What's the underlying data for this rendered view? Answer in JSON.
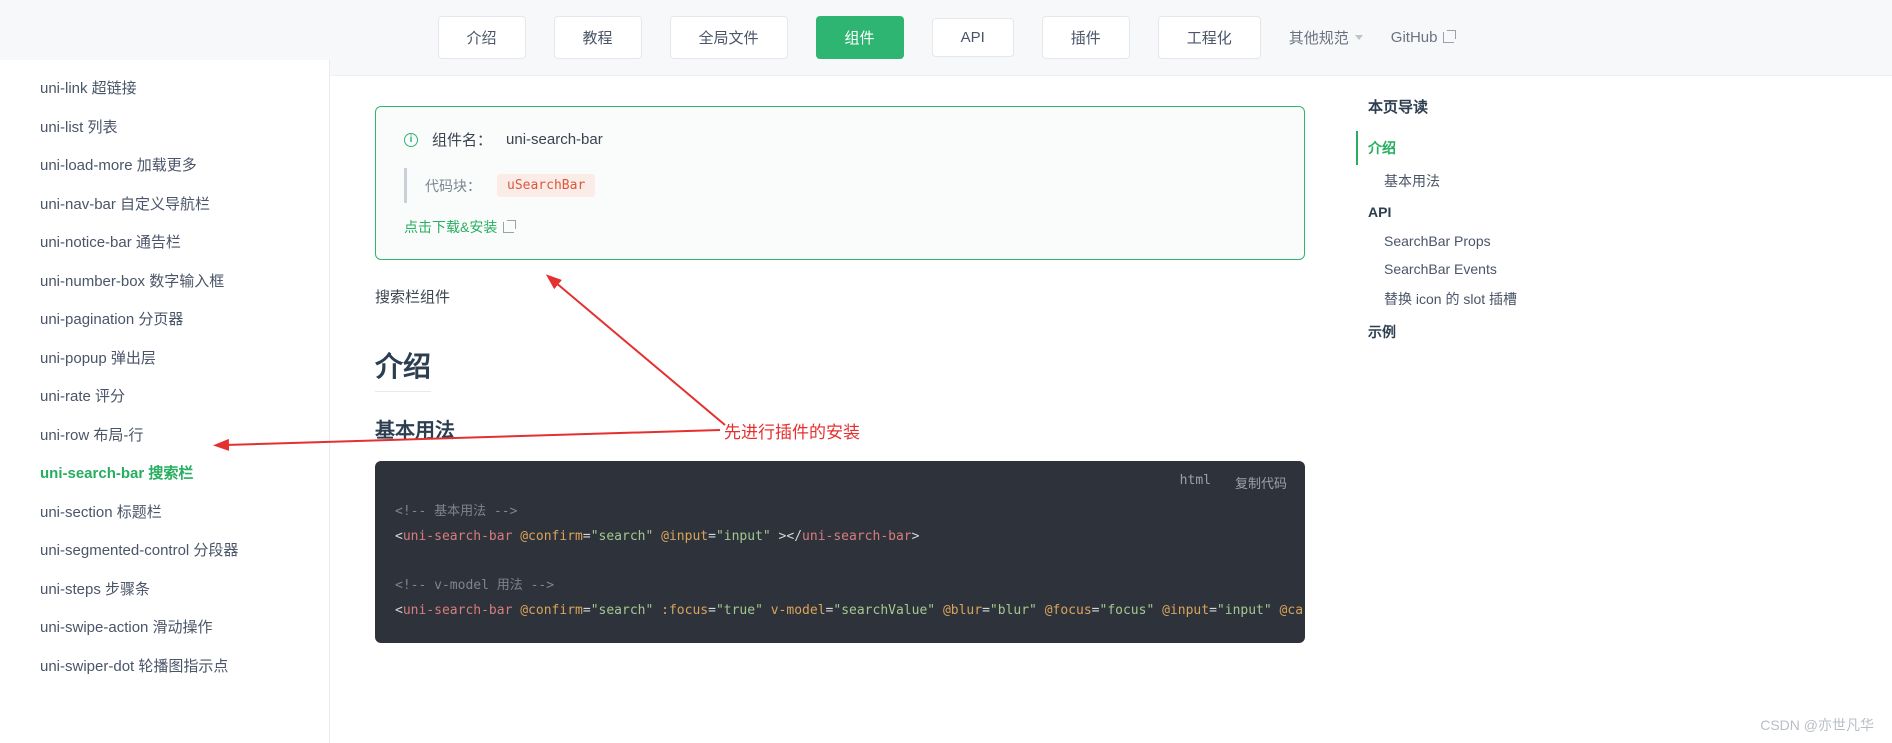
{
  "nav": {
    "items": [
      {
        "label": "介绍",
        "active": false
      },
      {
        "label": "教程",
        "active": false
      },
      {
        "label": "全局文件",
        "active": false
      },
      {
        "label": "组件",
        "active": true
      },
      {
        "label": "API",
        "active": false
      },
      {
        "label": "插件",
        "active": false
      },
      {
        "label": "工程化",
        "active": false
      }
    ],
    "other": "其他规范",
    "github": "GitHub"
  },
  "sidebar": {
    "items": [
      {
        "label": "uni-link 超链接"
      },
      {
        "label": "uni-list 列表"
      },
      {
        "label": "uni-load-more 加载更多"
      },
      {
        "label": "uni-nav-bar 自定义导航栏"
      },
      {
        "label": "uni-notice-bar 通告栏"
      },
      {
        "label": "uni-number-box 数字输入框"
      },
      {
        "label": "uni-pagination 分页器"
      },
      {
        "label": "uni-popup 弹出层"
      },
      {
        "label": "uni-rate 评分"
      },
      {
        "label": "uni-row 布局-行"
      },
      {
        "label": "uni-search-bar 搜索栏",
        "active": true
      },
      {
        "label": "uni-section 标题栏"
      },
      {
        "label": "uni-segmented-control 分段器"
      },
      {
        "label": "uni-steps 步骤条"
      },
      {
        "label": "uni-swipe-action 滑动操作"
      },
      {
        "label": "uni-swiper-dot 轮播图指示点"
      }
    ]
  },
  "card": {
    "name_label": "组件名：",
    "name_value": "uni-search-bar",
    "code_block_label": "代码块：",
    "code_block_value": "uSearchBar",
    "download": "点击下载&安装"
  },
  "main": {
    "desc": "搜索栏组件",
    "h2_intro": "介绍",
    "h3_basic": "基本用法"
  },
  "codebox": {
    "lang": "html",
    "copy": "复制代码",
    "lines": [
      {
        "type": "comment",
        "text": "<!-- 基本用法 -->"
      },
      {
        "type": "tag1"
      },
      {
        "type": "blank"
      },
      {
        "type": "comment",
        "text": "<!-- v-model 用法 -->"
      },
      {
        "type": "tag2"
      }
    ],
    "t1": {
      "tag": "uni-search-bar",
      "confirm": "search",
      "input": "input"
    },
    "t2": {
      "tag": "uni-search-bar",
      "confirm": "search",
      "focus": "true",
      "vmodel": "searchValue",
      "blur": "blur",
      "focusEvt": "focus",
      "input": "input",
      "car": "@ca"
    }
  },
  "toc": {
    "title": "本页导读",
    "items": [
      {
        "label": "介绍",
        "level": 1,
        "active": true
      },
      {
        "label": "基本用法",
        "level": 2
      },
      {
        "label": "API",
        "level": 1
      },
      {
        "label": "SearchBar Props",
        "level": 2
      },
      {
        "label": "SearchBar Events",
        "level": 2
      },
      {
        "label": "替换 icon 的 slot 插槽",
        "level": 2
      },
      {
        "label": "示例",
        "level": 1
      }
    ]
  },
  "annotation": {
    "text": "先进行插件的安装"
  },
  "watermark": "CSDN @亦世凡华"
}
